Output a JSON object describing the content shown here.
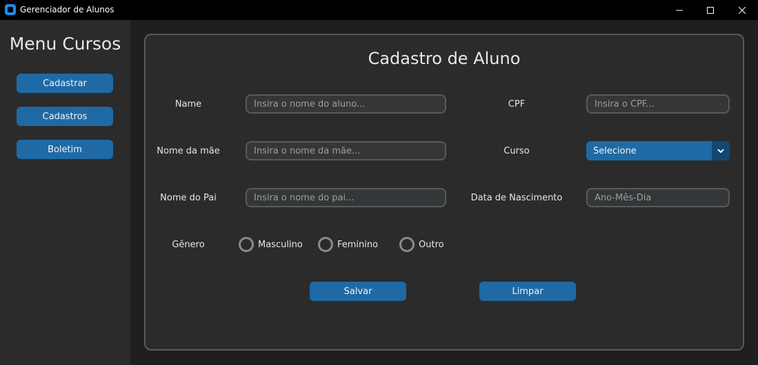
{
  "window": {
    "title": "Gerenciador de Alunos",
    "controls": [
      "minimize-icon",
      "maximize-icon",
      "close-icon"
    ]
  },
  "sidebar": {
    "title": "Menu Cursos",
    "items": [
      {
        "label": "Cadastrar"
      },
      {
        "label": "Cadastros"
      },
      {
        "label": "Boletim"
      }
    ]
  },
  "form": {
    "title": "Cadastro de Aluno",
    "name": {
      "label": "Name",
      "placeholder": "Insira o nome do aluno..."
    },
    "cpf": {
      "label": "CPF",
      "placeholder": "Insira o CPF..."
    },
    "mother": {
      "label": "Nome da mãe",
      "placeholder": "Insira o nome da mãe..."
    },
    "course": {
      "label": "Curso",
      "selected": "Selecione"
    },
    "father": {
      "label": "Nome do Pai",
      "placeholder": "Insira o nome do pai..."
    },
    "birthdate": {
      "label": "Data de Nascimento",
      "placeholder": "Ano-Mês-Dia"
    },
    "gender": {
      "label": "Gênero",
      "options": [
        "Masculino",
        "Feminino",
        "Outro"
      ]
    },
    "save_label": "Salvar",
    "clear_label": "Limpar"
  },
  "colors": {
    "accent": "#1f6aa5",
    "accent_dark": "#144870",
    "panel_bg": "#2b2b2b",
    "field_bg": "#343638",
    "border": "#565b5e"
  }
}
